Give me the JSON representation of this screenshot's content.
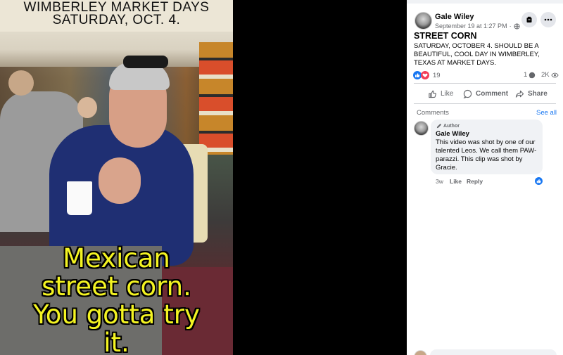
{
  "video": {
    "overlay_title_line1": "WIMBERLEY MARKET DAYS",
    "overlay_title_line2": "SATURDAY, OCT. 4.",
    "subtitle_lines": [
      "Mexican",
      "street corn.",
      "You gotta try",
      "it."
    ],
    "colors": {
      "subtitle": "#f4f422",
      "background": "#000000"
    }
  },
  "post": {
    "author": "Gale Wiley",
    "date": "September 19 at 1:27 PM",
    "title": "STREET CORN",
    "body": "SATURDAY, OCTOBER 4. SHOULD BE A BEAUTIFUL, COOL DAY IN WIMBERLEY, TEXAS AT MARKET DAYS.",
    "reactions_count": "19",
    "comments_count": "1",
    "views_count": "2K",
    "actions": {
      "like": "Like",
      "comment": "Comment",
      "share": "Share"
    },
    "icons": [
      "globe-icon",
      "save-icon",
      "more-icon",
      "like-reaction-icon",
      "love-reaction-icon",
      "comment-bubble-icon",
      "eye-icon",
      "thumb-up-icon",
      "share-arrow-icon",
      "pencil-icon"
    ]
  },
  "comments": {
    "header": "Comments",
    "see_all": "See all",
    "items": [
      {
        "badge": "Author",
        "author": "Gale Wiley",
        "text": "This video was shot by one of our talented Leos. We call them PAW-parazzi. This clip was shot by Gracie.",
        "age": "3w",
        "like": "Like",
        "reply": "Reply"
      }
    ]
  },
  "colors": {
    "link": "#1877f2",
    "love": "#f33e58",
    "panel": "#ffffff",
    "muted": "#65676b"
  }
}
